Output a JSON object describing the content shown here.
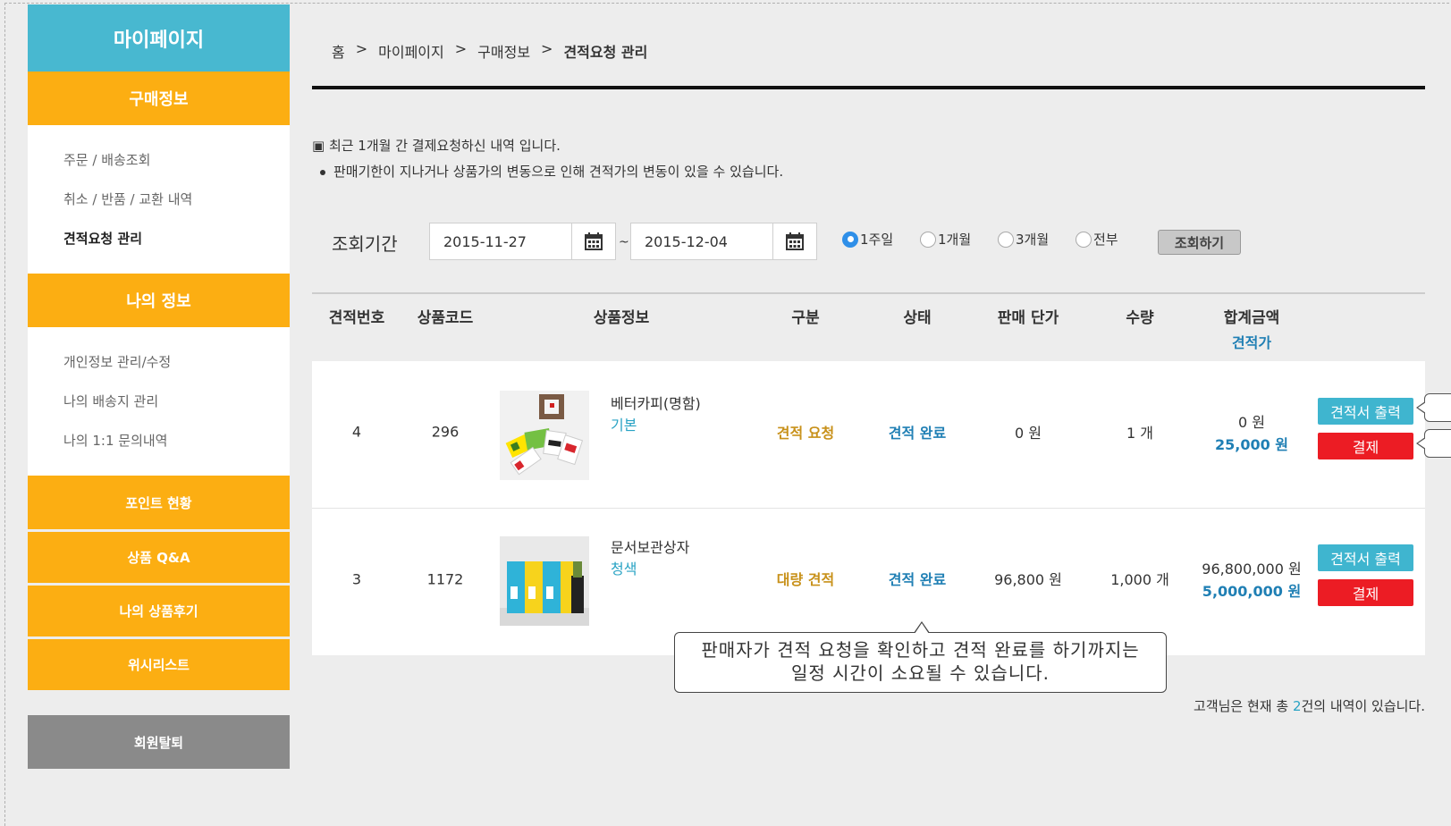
{
  "sidebar": {
    "title": "마이페이지",
    "section1": "구매정보",
    "section1_items": [
      {
        "label": "주문 / 배송조회"
      },
      {
        "label": "취소 / 반품 / 교환 내역"
      },
      {
        "label": "견적요청 관리"
      }
    ],
    "section2": "나의 정보",
    "section2_items": [
      {
        "label": "개인정보 관리/수정"
      },
      {
        "label": "나의 배송지 관리"
      },
      {
        "label": "나의 1:1 문의내역"
      }
    ],
    "buttons": [
      "포인트 현황",
      "상품 Q&A",
      "나의 상품후기",
      "위시리스트"
    ],
    "withdraw": "회원탈퇴"
  },
  "breadcrumb": {
    "home": "홈",
    "sep": ">",
    "level1": "마이페이지",
    "level2": "구매정보",
    "current": "견적요청 관리"
  },
  "notices": {
    "line1": "▣ 최근 1개월 간 결제요청하신 내역 입니다.",
    "line2": "판매기한이 지나거나 상품가의 변동으로 인해 견적가의 변동이 있을 수 있습니다."
  },
  "filter": {
    "label": "조회기간",
    "start_date": "2015-11-27",
    "tilde": "~",
    "end_date": "2015-12-04",
    "periods": [
      {
        "label": "1주일",
        "selected": true
      },
      {
        "label": "1개월",
        "selected": false
      },
      {
        "label": "3개월",
        "selected": false
      },
      {
        "label": "전부",
        "selected": false
      }
    ],
    "search_label": "조회하기"
  },
  "table": {
    "headers": {
      "no": "견적번호",
      "code": "상품코드",
      "info": "상품정보",
      "type": "구분",
      "status": "상태",
      "price": "판매 단가",
      "qty": "수량",
      "total": "합계금액",
      "total_sub": "견적가"
    },
    "rows": [
      {
        "no": "4",
        "code": "296",
        "name": "베터카피(명함)",
        "option": "기본",
        "type": "견적 요청",
        "status": "견적 완료",
        "price": "0 원",
        "qty": "1 개",
        "total": "0 원",
        "quote": "25,000 원",
        "btn_quote": "견적서 출력",
        "btn_pay": "결제"
      },
      {
        "no": "3",
        "code": "1172",
        "name": "문서보관상자",
        "option": "청색",
        "type": "대량 견적",
        "status": "견적 완료",
        "price": "96,800 원",
        "qty": "1,000 개",
        "total": "96,800,000 원",
        "quote": "5,000,000 원",
        "btn_quote": "견적서 출력",
        "btn_pay": "결제"
      }
    ]
  },
  "tooltip": {
    "line1": "판매자가 견적 요청을 확인하고 견적 완료를 하기까지는",
    "line2": "일정 시간이 소요될 수 있습니다."
  },
  "summary": {
    "prefix": "고객님은 현재 총 ",
    "count": "2",
    "suffix": "건의 내역이 있습니다."
  },
  "colors": {
    "sidebar_title": "#48b8d0",
    "sidebar_section": "#fcae12",
    "quote_button": "#3fb5cf",
    "pay_button": "#ec1c24",
    "accent_blue": "#1f7fb4"
  }
}
